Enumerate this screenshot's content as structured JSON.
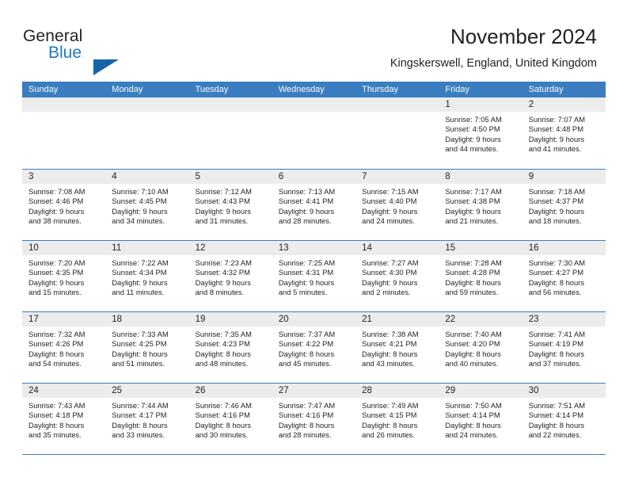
{
  "brand": {
    "word1": "General",
    "word2": "Blue",
    "triangle_color": "#1464ac",
    "blue_text_color": "#1c7ac0"
  },
  "header": {
    "title": "November 2024",
    "location": "Kingskerswell, England, United Kingdom"
  },
  "theme": {
    "header_blue": "#3a7ec0",
    "day_number_bg": "#ececec",
    "text": "#231f20"
  },
  "weekdays": [
    "Sunday",
    "Monday",
    "Tuesday",
    "Wednesday",
    "Thursday",
    "Friday",
    "Saturday"
  ],
  "weeks": [
    [
      {
        "day": "",
        "empty": true,
        "sunrise": "",
        "sunset": "",
        "daylight_line1": "",
        "daylight_line2": ""
      },
      {
        "day": "",
        "empty": true,
        "sunrise": "",
        "sunset": "",
        "daylight_line1": "",
        "daylight_line2": ""
      },
      {
        "day": "",
        "empty": true,
        "sunrise": "",
        "sunset": "",
        "daylight_line1": "",
        "daylight_line2": ""
      },
      {
        "day": "",
        "empty": true,
        "sunrise": "",
        "sunset": "",
        "daylight_line1": "",
        "daylight_line2": ""
      },
      {
        "day": "",
        "empty": true,
        "sunrise": "",
        "sunset": "",
        "daylight_line1": "",
        "daylight_line2": ""
      },
      {
        "day": "1",
        "empty": false,
        "sunrise": "Sunrise: 7:05 AM",
        "sunset": "Sunset: 4:50 PM",
        "daylight_line1": "Daylight: 9 hours",
        "daylight_line2": "and 44 minutes."
      },
      {
        "day": "2",
        "empty": false,
        "sunrise": "Sunrise: 7:07 AM",
        "sunset": "Sunset: 4:48 PM",
        "daylight_line1": "Daylight: 9 hours",
        "daylight_line2": "and 41 minutes."
      }
    ],
    [
      {
        "day": "3",
        "empty": false,
        "sunrise": "Sunrise: 7:08 AM",
        "sunset": "Sunset: 4:46 PM",
        "daylight_line1": "Daylight: 9 hours",
        "daylight_line2": "and 38 minutes."
      },
      {
        "day": "4",
        "empty": false,
        "sunrise": "Sunrise: 7:10 AM",
        "sunset": "Sunset: 4:45 PM",
        "daylight_line1": "Daylight: 9 hours",
        "daylight_line2": "and 34 minutes."
      },
      {
        "day": "5",
        "empty": false,
        "sunrise": "Sunrise: 7:12 AM",
        "sunset": "Sunset: 4:43 PM",
        "daylight_line1": "Daylight: 9 hours",
        "daylight_line2": "and 31 minutes."
      },
      {
        "day": "6",
        "empty": false,
        "sunrise": "Sunrise: 7:13 AM",
        "sunset": "Sunset: 4:41 PM",
        "daylight_line1": "Daylight: 9 hours",
        "daylight_line2": "and 28 minutes."
      },
      {
        "day": "7",
        "empty": false,
        "sunrise": "Sunrise: 7:15 AM",
        "sunset": "Sunset: 4:40 PM",
        "daylight_line1": "Daylight: 9 hours",
        "daylight_line2": "and 24 minutes."
      },
      {
        "day": "8",
        "empty": false,
        "sunrise": "Sunrise: 7:17 AM",
        "sunset": "Sunset: 4:38 PM",
        "daylight_line1": "Daylight: 9 hours",
        "daylight_line2": "and 21 minutes."
      },
      {
        "day": "9",
        "empty": false,
        "sunrise": "Sunrise: 7:18 AM",
        "sunset": "Sunset: 4:37 PM",
        "daylight_line1": "Daylight: 9 hours",
        "daylight_line2": "and 18 minutes."
      }
    ],
    [
      {
        "day": "10",
        "empty": false,
        "sunrise": "Sunrise: 7:20 AM",
        "sunset": "Sunset: 4:35 PM",
        "daylight_line1": "Daylight: 9 hours",
        "daylight_line2": "and 15 minutes."
      },
      {
        "day": "11",
        "empty": false,
        "sunrise": "Sunrise: 7:22 AM",
        "sunset": "Sunset: 4:34 PM",
        "daylight_line1": "Daylight: 9 hours",
        "daylight_line2": "and 11 minutes."
      },
      {
        "day": "12",
        "empty": false,
        "sunrise": "Sunrise: 7:23 AM",
        "sunset": "Sunset: 4:32 PM",
        "daylight_line1": "Daylight: 9 hours",
        "daylight_line2": "and 8 minutes."
      },
      {
        "day": "13",
        "empty": false,
        "sunrise": "Sunrise: 7:25 AM",
        "sunset": "Sunset: 4:31 PM",
        "daylight_line1": "Daylight: 9 hours",
        "daylight_line2": "and 5 minutes."
      },
      {
        "day": "14",
        "empty": false,
        "sunrise": "Sunrise: 7:27 AM",
        "sunset": "Sunset: 4:30 PM",
        "daylight_line1": "Daylight: 9 hours",
        "daylight_line2": "and 2 minutes."
      },
      {
        "day": "15",
        "empty": false,
        "sunrise": "Sunrise: 7:28 AM",
        "sunset": "Sunset: 4:28 PM",
        "daylight_line1": "Daylight: 8 hours",
        "daylight_line2": "and 59 minutes."
      },
      {
        "day": "16",
        "empty": false,
        "sunrise": "Sunrise: 7:30 AM",
        "sunset": "Sunset: 4:27 PM",
        "daylight_line1": "Daylight: 8 hours",
        "daylight_line2": "and 56 minutes."
      }
    ],
    [
      {
        "day": "17",
        "empty": false,
        "sunrise": "Sunrise: 7:32 AM",
        "sunset": "Sunset: 4:26 PM",
        "daylight_line1": "Daylight: 8 hours",
        "daylight_line2": "and 54 minutes."
      },
      {
        "day": "18",
        "empty": false,
        "sunrise": "Sunrise: 7:33 AM",
        "sunset": "Sunset: 4:25 PM",
        "daylight_line1": "Daylight: 8 hours",
        "daylight_line2": "and 51 minutes."
      },
      {
        "day": "19",
        "empty": false,
        "sunrise": "Sunrise: 7:35 AM",
        "sunset": "Sunset: 4:23 PM",
        "daylight_line1": "Daylight: 8 hours",
        "daylight_line2": "and 48 minutes."
      },
      {
        "day": "20",
        "empty": false,
        "sunrise": "Sunrise: 7:37 AM",
        "sunset": "Sunset: 4:22 PM",
        "daylight_line1": "Daylight: 8 hours",
        "daylight_line2": "and 45 minutes."
      },
      {
        "day": "21",
        "empty": false,
        "sunrise": "Sunrise: 7:38 AM",
        "sunset": "Sunset: 4:21 PM",
        "daylight_line1": "Daylight: 8 hours",
        "daylight_line2": "and 43 minutes."
      },
      {
        "day": "22",
        "empty": false,
        "sunrise": "Sunrise: 7:40 AM",
        "sunset": "Sunset: 4:20 PM",
        "daylight_line1": "Daylight: 8 hours",
        "daylight_line2": "and 40 minutes."
      },
      {
        "day": "23",
        "empty": false,
        "sunrise": "Sunrise: 7:41 AM",
        "sunset": "Sunset: 4:19 PM",
        "daylight_line1": "Daylight: 8 hours",
        "daylight_line2": "and 37 minutes."
      }
    ],
    [
      {
        "day": "24",
        "empty": false,
        "sunrise": "Sunrise: 7:43 AM",
        "sunset": "Sunset: 4:18 PM",
        "daylight_line1": "Daylight: 8 hours",
        "daylight_line2": "and 35 minutes."
      },
      {
        "day": "25",
        "empty": false,
        "sunrise": "Sunrise: 7:44 AM",
        "sunset": "Sunset: 4:17 PM",
        "daylight_line1": "Daylight: 8 hours",
        "daylight_line2": "and 33 minutes."
      },
      {
        "day": "26",
        "empty": false,
        "sunrise": "Sunrise: 7:46 AM",
        "sunset": "Sunset: 4:16 PM",
        "daylight_line1": "Daylight: 8 hours",
        "daylight_line2": "and 30 minutes."
      },
      {
        "day": "27",
        "empty": false,
        "sunrise": "Sunrise: 7:47 AM",
        "sunset": "Sunset: 4:16 PM",
        "daylight_line1": "Daylight: 8 hours",
        "daylight_line2": "and 28 minutes."
      },
      {
        "day": "28",
        "empty": false,
        "sunrise": "Sunrise: 7:49 AM",
        "sunset": "Sunset: 4:15 PM",
        "daylight_line1": "Daylight: 8 hours",
        "daylight_line2": "and 26 minutes."
      },
      {
        "day": "29",
        "empty": false,
        "sunrise": "Sunrise: 7:50 AM",
        "sunset": "Sunset: 4:14 PM",
        "daylight_line1": "Daylight: 8 hours",
        "daylight_line2": "and 24 minutes."
      },
      {
        "day": "30",
        "empty": false,
        "sunrise": "Sunrise: 7:51 AM",
        "sunset": "Sunset: 4:14 PM",
        "daylight_line1": "Daylight: 8 hours",
        "daylight_line2": "and 22 minutes."
      }
    ]
  ]
}
